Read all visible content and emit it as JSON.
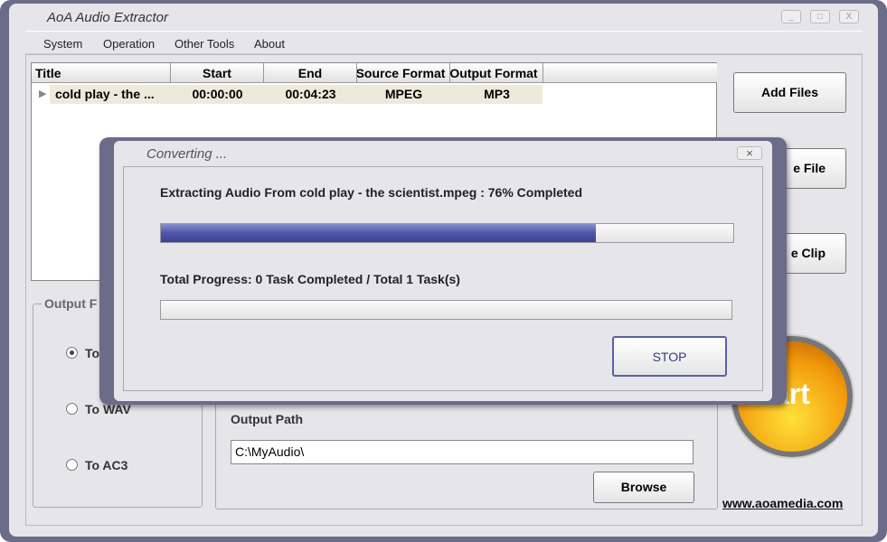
{
  "window": {
    "title": "AoA Audio Extractor",
    "controls": [
      "_",
      "□",
      "X"
    ]
  },
  "menu": [
    "System",
    "Operation",
    "Other Tools",
    "About"
  ],
  "table": {
    "headers": [
      "Title",
      "Start",
      "End",
      "Source Format",
      "Output Format"
    ],
    "rows": [
      [
        "cold play - the ...",
        "00:00:00",
        "00:04:23",
        "MPEG",
        "MP3"
      ]
    ]
  },
  "buttons": {
    "add_files": "Add Files",
    "remove_file": "e File",
    "clip": "e Clip",
    "browse": "Browse",
    "start": "art"
  },
  "output_format": {
    "legend": "Output F",
    "options": [
      "To",
      "To WAV",
      "To AC3"
    ],
    "selected": 0
  },
  "output_path": {
    "label": "Output Path",
    "value": "C:\\MyAudio\\"
  },
  "link": "www.aoamedia.com",
  "dialog": {
    "title": "Converting ...",
    "close": "×",
    "status": "Extracting Audio From  cold play - the scientist.mpeg  :  76% Completed",
    "file_progress": 76,
    "total_label": "Total Progress: 0 Task Completed / Total 1 Task(s)",
    "total_progress": 0,
    "stop": "STOP"
  }
}
